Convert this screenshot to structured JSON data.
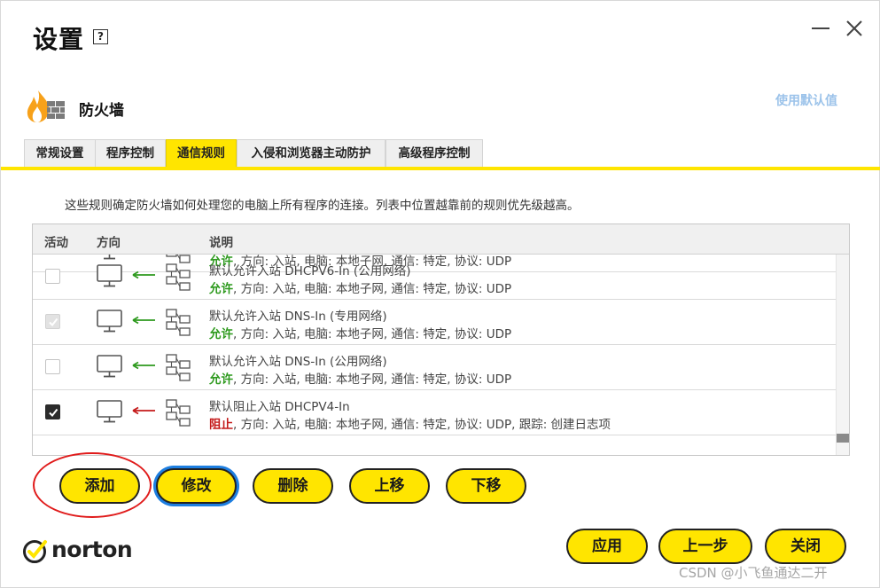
{
  "window": {
    "title": "设置",
    "help_icon": "?",
    "controls": {
      "minimize": "minimize-icon",
      "close": "close-icon"
    }
  },
  "section": {
    "icon": "firewall-icon",
    "title": "防火墙",
    "default_link": "使用默认值"
  },
  "tabs": [
    {
      "label": "常规设置",
      "active": false
    },
    {
      "label": "程序控制",
      "active": false
    },
    {
      "label": "通信规则",
      "active": true
    },
    {
      "label": "入侵和浏览器主动防护",
      "active": false
    },
    {
      "label": "高级程序控制",
      "active": false
    }
  ],
  "description": "这些规则确定防火墙如何处理您的电脑上所有程序的连接。列表中位置越靠前的规则优先级越高。",
  "table": {
    "columns": {
      "active": "活动",
      "direction": "方向",
      "description": "说明"
    },
    "partial_row": {
      "action": "允许",
      "detail": ", 方向: 入站, 电脑: 本地子网, 通信: 特定, 协议: UDP"
    },
    "rows": [
      {
        "checked": false,
        "disabled": true,
        "direction": "inbound",
        "action_type": "allow",
        "name": "默认允许入站 DHCPV6-In (公用网络)",
        "action": "允许",
        "detail": ", 方向: 入站, 电脑: 本地子网, 通信: 特定, 协议: UDP"
      },
      {
        "checked": true,
        "disabled": true,
        "direction": "inbound",
        "action_type": "allow",
        "name": "默认允许入站 DNS-In (专用网络)",
        "action": "允许",
        "detail": ", 方向: 入站, 电脑: 本地子网, 通信: 特定, 协议: UDP"
      },
      {
        "checked": false,
        "disabled": true,
        "direction": "inbound",
        "action_type": "allow",
        "name": "默认允许入站 DNS-In (公用网络)",
        "action": "允许",
        "detail": ", 方向: 入站, 电脑: 本地子网, 通信: 特定, 协议: UDP"
      },
      {
        "checked": true,
        "disabled": false,
        "direction": "inbound",
        "action_type": "block",
        "name": "默认阻止入站 DHCPV4-In",
        "action": "阻止",
        "detail": ", 方向: 入站, 电脑: 本地子网, 通信: 特定, 协议: UDP, 跟踪: 创建日志项"
      }
    ]
  },
  "row_buttons": {
    "add": "添加",
    "modify": "修改",
    "delete": "删除",
    "move_up": "上移",
    "move_down": "下移"
  },
  "footer_buttons": {
    "apply": "应用",
    "back": "上一步",
    "close": "关闭"
  },
  "brand": {
    "logo_text": "norton"
  },
  "watermark": "CSDN @小飞鱼通达二开",
  "colors": {
    "accent_yellow": "#ffe500",
    "allow_green": "#2e9a1e",
    "block_red": "#c41a1a",
    "focus_blue": "#1d7ee0",
    "annotation_red": "#e01b1b",
    "link_blue": "#9cc3ea"
  }
}
